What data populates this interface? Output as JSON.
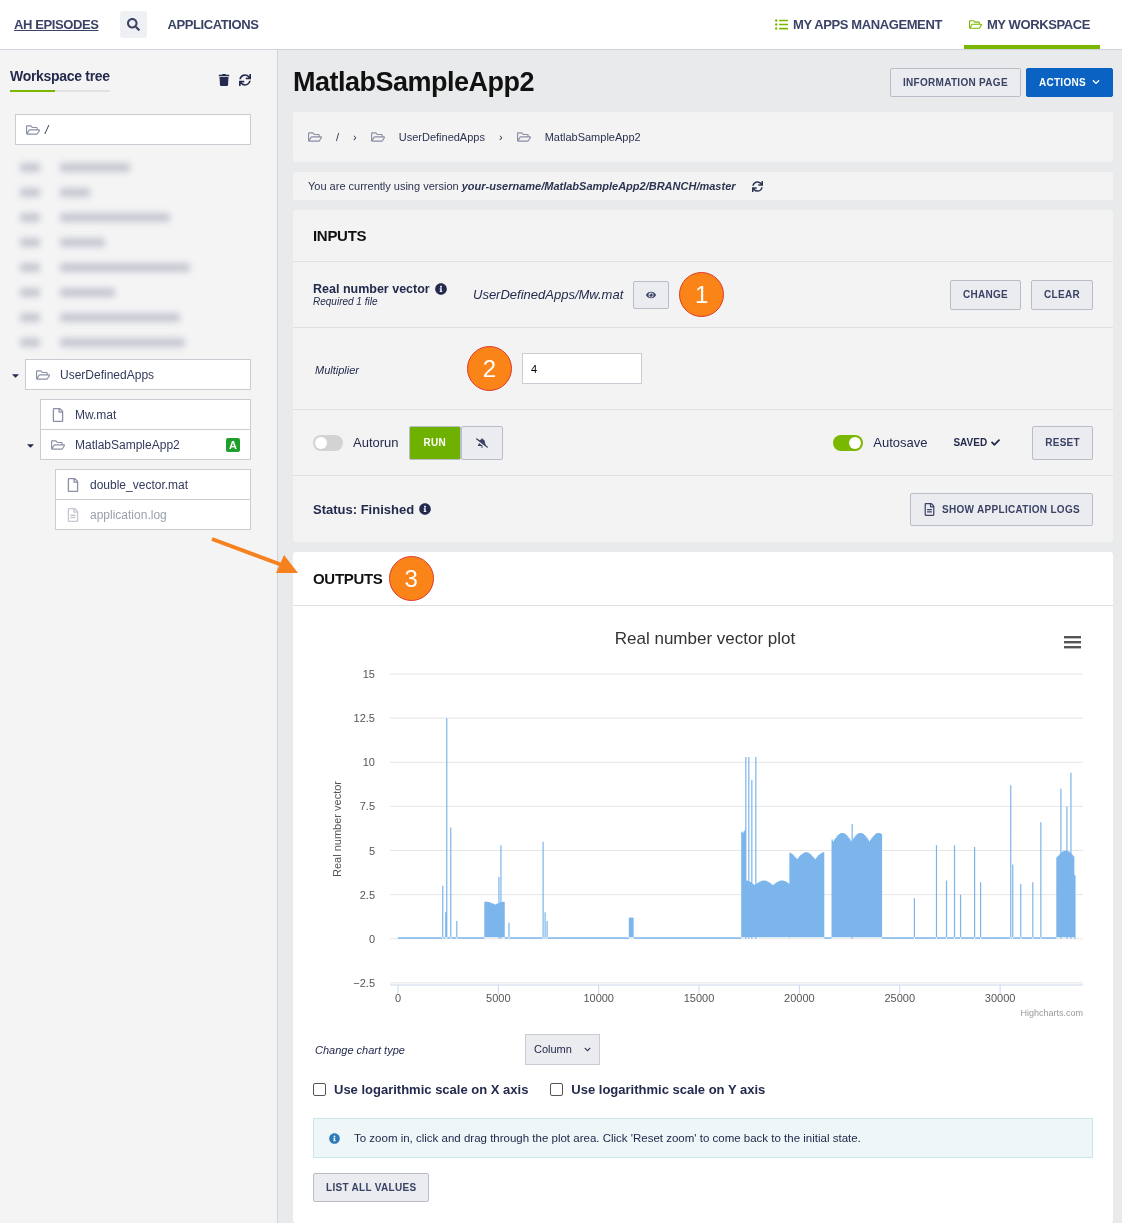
{
  "nav": {
    "left": [
      {
        "label": "AH EPISODES"
      },
      {
        "label": "APPLICATIONS"
      }
    ],
    "right": [
      {
        "label": "MY APPS MANAGEMENT",
        "kind": "list",
        "selected": false
      },
      {
        "label": "MY WORKSPACE",
        "kind": "folder",
        "selected": true
      }
    ]
  },
  "sidebar": {
    "title": "Workspace tree",
    "root_path": "/",
    "tree": [
      {
        "label": "UserDefinedApps",
        "kind": "folder",
        "expanded": true,
        "children": [
          {
            "label": "Mw.mat",
            "kind": "file",
            "disabled": false
          },
          {
            "label": "MatlabSampleApp2",
            "kind": "folder",
            "expanded": true,
            "badge": "A",
            "children": [
              {
                "label": "double_vector.mat",
                "kind": "file",
                "disabled": false
              },
              {
                "label": "application.log",
                "kind": "file",
                "disabled": true
              }
            ]
          }
        ]
      }
    ]
  },
  "page": {
    "title": "MatlabSampleApp2",
    "buttons": [
      {
        "label": "INFORMATION PAGE",
        "kind": "default"
      },
      {
        "label": "ACTIONS",
        "kind": "primary"
      }
    ]
  },
  "breadcrumb": {
    "items": [
      "/",
      "UserDefinedApps",
      "MatlabSampleApp2"
    ],
    "separators": [
      "›",
      "›"
    ]
  },
  "version": {
    "text": "You are currently using version ",
    "value": "your-username/MatlabSampleApp2/BRANCH/master"
  },
  "inputs": {
    "heading": "INPUTS",
    "file_input": {
      "label": "Real number vector",
      "hint": "Required 1 file",
      "value": "UserDefinedApps/Mw.mat",
      "annotation": "1",
      "buttons": [
        "CHANGE",
        "CLEAR"
      ]
    },
    "number_input": {
      "label": "Multiplier",
      "value": "4",
      "annotation": "2"
    },
    "autorun": {
      "label": "Autorun",
      "on": false
    },
    "run_button": "RUN",
    "autosave": {
      "label": "Autosave",
      "on": true
    },
    "saved": "SAVED",
    "reset_button": "RESET",
    "status": "Status: Finished",
    "logs_button": "SHOW APPLICATION LOGS"
  },
  "outputs": {
    "heading": "OUTPUTS",
    "annotation": "3",
    "chart": {
      "title": "Real number vector plot",
      "ylabel": "Real number vector",
      "y_tick_labels": [
        "15",
        "12.5",
        "10",
        "7.5",
        "5",
        "2.5",
        "0",
        "−2.5"
      ],
      "x_tick_labels": [
        "0",
        "5000",
        "10000",
        "15000",
        "20000",
        "25000",
        "30000"
      ],
      "credits": "Highcharts.com"
    },
    "chart_type": {
      "label": "Change chart type",
      "value": "Column"
    },
    "options": [
      {
        "label": "Use logarithmic scale on X axis",
        "checked": false
      },
      {
        "label": "Use logarithmic scale on Y axis",
        "checked": false
      }
    ],
    "info": "To zoom in, click and drag through the plot area. Click 'Reset zoom' to come back to the initial state.",
    "list_button": "LIST ALL VALUES"
  }
}
